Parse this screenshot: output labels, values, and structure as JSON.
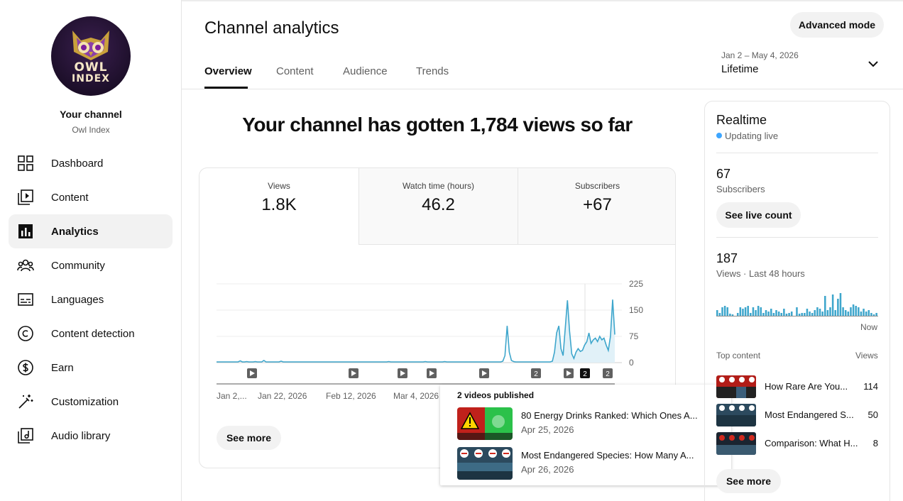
{
  "sidebar": {
    "avatar": {
      "line1": "OWL",
      "line2": "INDEX"
    },
    "channel_title": "Your channel",
    "channel_name": "Owl Index",
    "items": [
      {
        "label": "Dashboard",
        "icon": "dashboard-icon",
        "active": false
      },
      {
        "label": "Content",
        "icon": "content-icon",
        "active": false
      },
      {
        "label": "Analytics",
        "icon": "analytics-icon",
        "active": true
      },
      {
        "label": "Community",
        "icon": "community-icon",
        "active": false
      },
      {
        "label": "Languages",
        "icon": "languages-icon",
        "active": false
      },
      {
        "label": "Content detection",
        "icon": "content-detection-icon",
        "active": false
      },
      {
        "label": "Earn",
        "icon": "earn-icon",
        "active": false
      },
      {
        "label": "Customization",
        "icon": "customization-icon",
        "active": false
      },
      {
        "label": "Audio library",
        "icon": "audio-library-icon",
        "active": false
      }
    ]
  },
  "header": {
    "title": "Channel analytics",
    "advanced_mode": "Advanced mode",
    "tabs": [
      {
        "label": "Overview",
        "active": true
      },
      {
        "label": "Content",
        "active": false
      },
      {
        "label": "Audience",
        "active": false
      },
      {
        "label": "Trends",
        "active": false
      }
    ],
    "date_range": "Jan 2 – May 4, 2026",
    "date_preset": "Lifetime"
  },
  "overview": {
    "headline": "Your channel has gotten 1,784 views so far",
    "metrics": [
      {
        "label": "Views",
        "value": "1.8K"
      },
      {
        "label": "Watch time (hours)",
        "value": "46.2"
      },
      {
        "label": "Subscribers",
        "value": "+67"
      }
    ],
    "see_more": "See more"
  },
  "chart_data": {
    "type": "area",
    "ylim": [
      0,
      225
    ],
    "y_ticks": [
      "225",
      "150",
      "75",
      "0"
    ],
    "x_tick_labels": [
      "Jan 2,...",
      "Jan 22, 2026",
      "Feb 12, 2026",
      "Mar 4, 2026"
    ],
    "series": [
      {
        "values": [
          2,
          2,
          2,
          2,
          2,
          2,
          2,
          2,
          2,
          2,
          2,
          5,
          2,
          2,
          3,
          2,
          2,
          2,
          3,
          2,
          2,
          2,
          6,
          2,
          2,
          2,
          2,
          2,
          2,
          2,
          4,
          2,
          2,
          2,
          2,
          2,
          2,
          2,
          2,
          2,
          2,
          2,
          2,
          2,
          2,
          2,
          2,
          2,
          2,
          2,
          2,
          2,
          2,
          2,
          2,
          2,
          2,
          2,
          2,
          2,
          2,
          2,
          2,
          2,
          2,
          2,
          2,
          2,
          2,
          2,
          2,
          2,
          2,
          2,
          2,
          2,
          2,
          2,
          2,
          2,
          3,
          2,
          2,
          2,
          2,
          2,
          2,
          2,
          2,
          2,
          2,
          2,
          2,
          2,
          2,
          2,
          2,
          3,
          2,
          2,
          2,
          2,
          2,
          2,
          2,
          2,
          3,
          2,
          2,
          2,
          2,
          2,
          2,
          2,
          2,
          2,
          2,
          2,
          2,
          2,
          2,
          2,
          2,
          2,
          2,
          2,
          2,
          2,
          2,
          2,
          2,
          2,
          2,
          4,
          20,
          105,
          30,
          6,
          3,
          2,
          2,
          2,
          2,
          2,
          2,
          2,
          2,
          2,
          2,
          2,
          2,
          2,
          2,
          2,
          2,
          2,
          4,
          30,
          85,
          105,
          40,
          20,
          100,
          178,
          90,
          25,
          12,
          30,
          40,
          32,
          35,
          50,
          60,
          85,
          55,
          65,
          70,
          60,
          75,
          65,
          70,
          50,
          35,
          75,
          180,
          80
        ]
      }
    ],
    "video_markers": [
      "▶",
      "▶",
      "▶",
      "▶",
      "▶",
      "2",
      "▶",
      "2",
      "2"
    ],
    "tooltip": {
      "title": "2 videos published",
      "items": [
        {
          "title": "80 Energy Drinks Ranked: Which Ones A...",
          "date": "Apr 25, 2026"
        },
        {
          "title": "Most Endangered Species: How Many A...",
          "date": "Apr 26, 2026"
        }
      ]
    }
  },
  "realtime": {
    "title": "Realtime",
    "status": "Updating live",
    "subscribers": "67",
    "subscribers_label": "Subscribers",
    "live_count_button": "See live count",
    "views": "187",
    "views_label": "Views · Last 48 hours",
    "bar_values": [
      8,
      4,
      12,
      14,
      12,
      3,
      2,
      0,
      4,
      12,
      10,
      12,
      14,
      4,
      12,
      8,
      14,
      12,
      4,
      8,
      6,
      10,
      4,
      8,
      6,
      4,
      10,
      3,
      4,
      6,
      0,
      12,
      3,
      4,
      4,
      10,
      6,
      4,
      8,
      12,
      10,
      6,
      28,
      8,
      12,
      30,
      8,
      24,
      32,
      12,
      8,
      6,
      12,
      16,
      14,
      12,
      6,
      10,
      6,
      8,
      4,
      2,
      4
    ],
    "now_label": "Now",
    "top_content_label": "Top content",
    "views_col_label": "Views",
    "top_content": [
      {
        "title": "How Rare Are You...",
        "views": "114"
      },
      {
        "title": "Most Endangered S...",
        "views": "50"
      },
      {
        "title": "Comparison: What H...",
        "views": "8"
      }
    ],
    "see_more": "See more"
  },
  "colors": {
    "accent": "#3ea6ff",
    "chart_line": "#3ea6cc",
    "chart_fill": "#e1f1f8"
  }
}
